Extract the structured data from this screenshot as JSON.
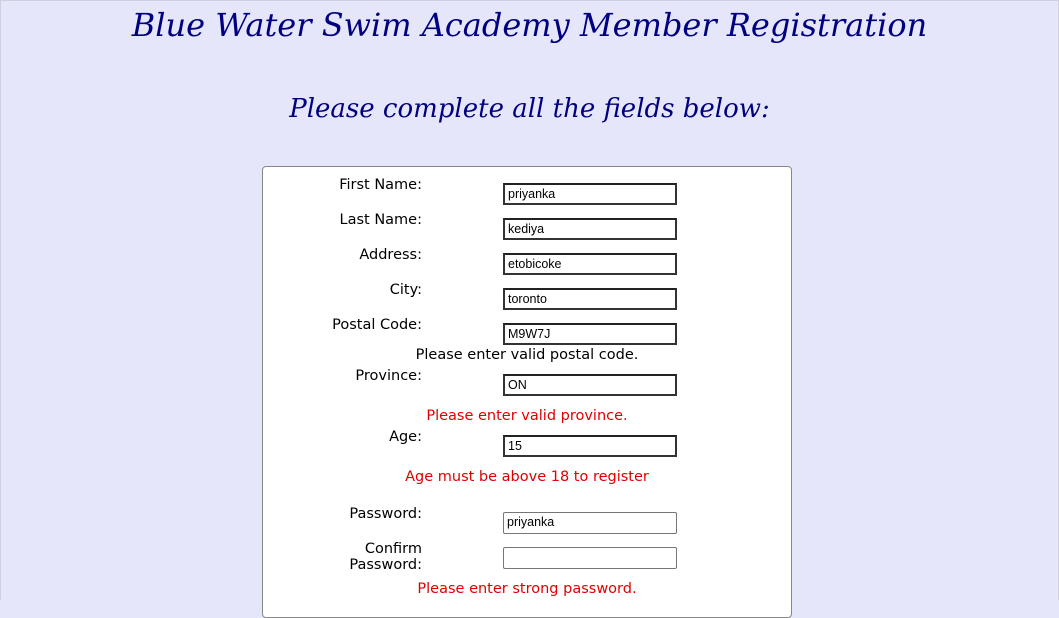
{
  "header": {
    "title": "Blue Water Swim Academy Member Registration",
    "subtitle": "Please complete all the fields below:"
  },
  "form": {
    "first_name": {
      "label": "First Name:",
      "value": "priyanka"
    },
    "last_name": {
      "label": "Last Name:",
      "value": "kediya"
    },
    "address": {
      "label": "Address:",
      "value": "etobicoke"
    },
    "city": {
      "label": "City:",
      "value": "toronto"
    },
    "postal_code": {
      "label": "Postal Code:",
      "value": "M9W7J"
    },
    "postal_code_message": "Please enter valid postal code.",
    "province": {
      "label": "Province:",
      "value": "ON"
    },
    "province_message": "Please enter valid province.",
    "age": {
      "label": "Age:",
      "value": "15"
    },
    "age_message": "Age must be above 18 to register",
    "password": {
      "label": "Password:",
      "value": "priyanka"
    },
    "confirm_password": {
      "label_line1": "Confirm",
      "label_line2": "Password:",
      "value": ""
    },
    "password_message": "Please enter strong password."
  },
  "colors": {
    "background": "#e6e6fa",
    "heading": "#000080",
    "error": "#e00000"
  }
}
